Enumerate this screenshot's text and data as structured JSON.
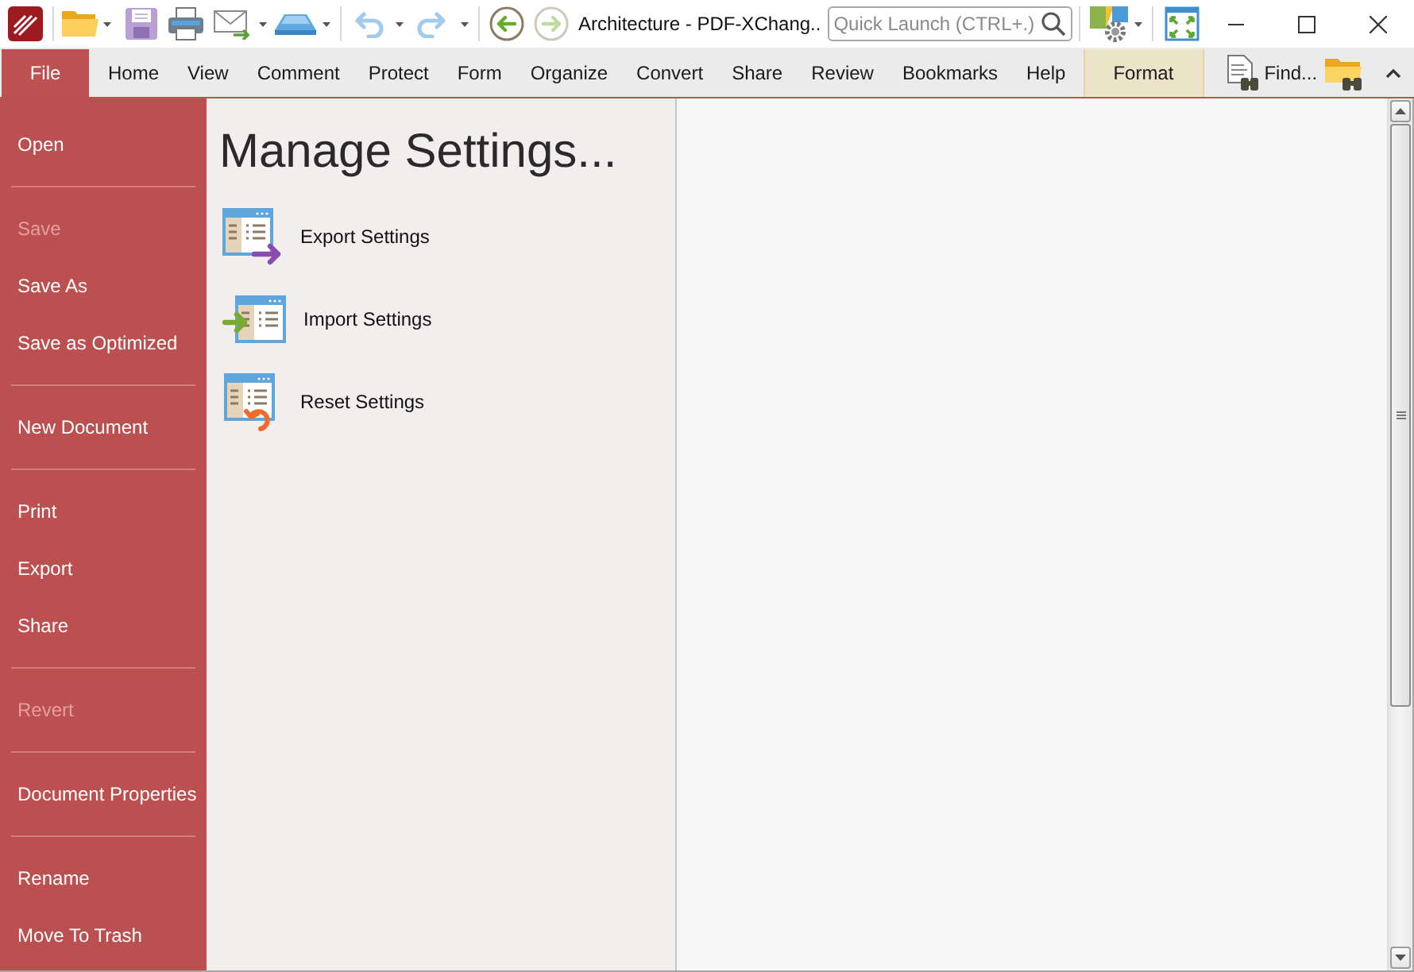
{
  "window": {
    "title": "Architecture - PDF-XChang.."
  },
  "quick_launch": {
    "placeholder": "Quick Launch (CTRL+.)"
  },
  "history_buttons": [
    {
      "kind": "back",
      "disabled": false
    },
    {
      "kind": "forward",
      "disabled": true
    }
  ],
  "ribbon": {
    "tabs": [
      {
        "label": "File",
        "kind": "file",
        "selected": true
      },
      {
        "label": "Home",
        "kind": "tab",
        "selected": false
      },
      {
        "label": "View",
        "kind": "tab",
        "selected": false
      },
      {
        "label": "Comment",
        "kind": "tab",
        "selected": false
      },
      {
        "label": "Protect",
        "kind": "tab",
        "selected": false
      },
      {
        "label": "Form",
        "kind": "tab",
        "selected": false
      },
      {
        "label": "Organize",
        "kind": "tab",
        "selected": false
      },
      {
        "label": "Convert",
        "kind": "tab",
        "selected": false
      },
      {
        "label": "Share",
        "kind": "tab",
        "selected": false
      },
      {
        "label": "Review",
        "kind": "tab",
        "selected": false
      },
      {
        "label": "Bookmarks",
        "kind": "tab",
        "selected": false
      },
      {
        "label": "Help",
        "kind": "tab",
        "selected": false
      },
      {
        "label": "Format",
        "kind": "contextual",
        "selected": false
      }
    ],
    "find": {
      "label": "Find..."
    }
  },
  "backstage": {
    "groups": [
      {
        "items": [
          {
            "label": "Open",
            "disabled": false
          }
        ]
      },
      {
        "items": [
          {
            "label": "Save",
            "disabled": true
          },
          {
            "label": "Save As",
            "disabled": false
          },
          {
            "label": "Save as Optimized",
            "disabled": false
          }
        ]
      },
      {
        "items": [
          {
            "label": "New Document",
            "disabled": false
          }
        ]
      },
      {
        "items": [
          {
            "label": "Print",
            "disabled": false
          },
          {
            "label": "Export",
            "disabled": false
          },
          {
            "label": "Share",
            "disabled": false
          }
        ]
      },
      {
        "items": [
          {
            "label": "Revert",
            "disabled": true
          }
        ]
      },
      {
        "items": [
          {
            "label": "Document Properties",
            "disabled": false
          }
        ]
      },
      {
        "items": [
          {
            "label": "Rename",
            "disabled": false
          },
          {
            "label": "Move To Trash",
            "disabled": false
          }
        ]
      }
    ]
  },
  "page": {
    "title": "Manage Settings...",
    "actions": [
      {
        "label": "Export Settings",
        "kind": "export"
      },
      {
        "label": "Import Settings",
        "kind": "import"
      },
      {
        "label": "Reset Settings",
        "kind": "reset"
      }
    ]
  }
}
